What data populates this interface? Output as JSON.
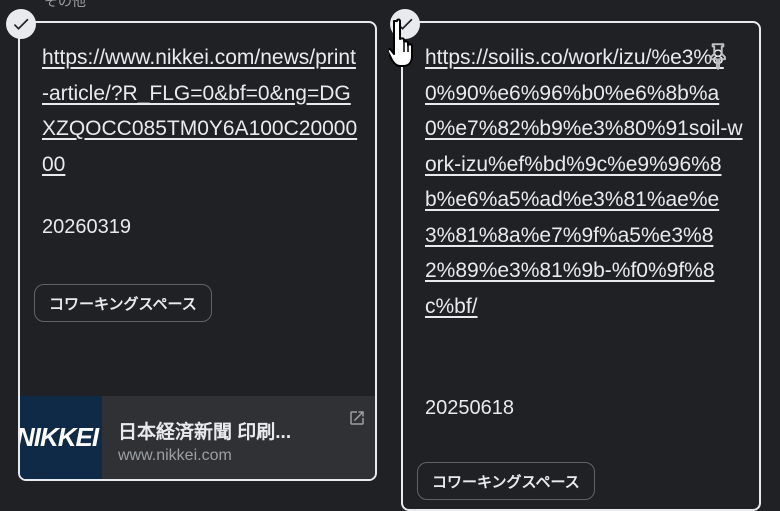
{
  "section": {
    "label": "その他"
  },
  "cards": [
    {
      "link": "https://www.nikkei.com/news/print-article/?R_FLG=0&bf=0&ng=DGXZQOCC085TM0Y6A100C2000000",
      "date": "20260319",
      "chip": "コワーキングスペース",
      "preview": {
        "thumb_text": "NIKKEI",
        "title": "日本経済新聞 印刷...",
        "domain": "www.nikkei.com"
      }
    },
    {
      "link": "https://soilis.co/work/izu/%e3%80%90%e6%96%b0%e6%8b%a0%e7%82%b9%e3%80%91soil-work-izu%ef%bd%9c%e9%96%8b%e6%a5%ad%e3%81%ae%e3%81%8a%e7%9f%a5%e3%82%89%e3%81%9b-%f0%9f%8c%bf/",
      "date": "20250618",
      "chip": "コワーキングスペース"
    }
  ],
  "icons": {
    "check": "check-circle-icon",
    "open": "open-in-new-icon",
    "pin": "pin-icon",
    "cursor": "hand-pointer-icon"
  },
  "colors": {
    "background": "#202124",
    "text": "#e8eaed",
    "muted": "#9aa0a6",
    "preview_bg": "#303134",
    "thumb_bg": "#0e2a47"
  }
}
